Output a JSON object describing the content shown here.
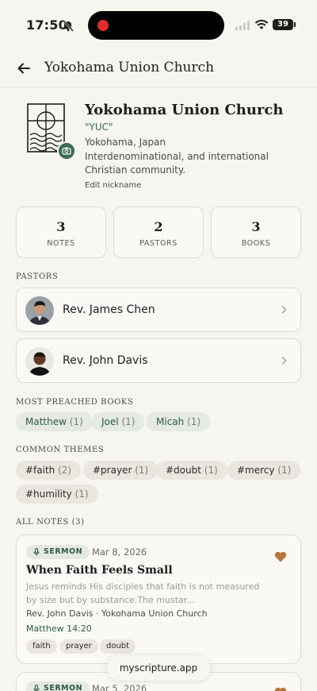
{
  "status_bar": {
    "time": "17:50",
    "battery": "39"
  },
  "header": {
    "title": "Yokohama Union Church"
  },
  "profile": {
    "name": "Yokohama Union Church",
    "nickname": "\"YUC\"",
    "location": "Yokohama, Japan",
    "description": "Interdenominational, and international Christian community.",
    "edit_nickname": "Edit nickname"
  },
  "stats": [
    {
      "value": "3",
      "label": "NOTES"
    },
    {
      "value": "2",
      "label": "PASTORS"
    },
    {
      "value": "3",
      "label": "BOOKS"
    }
  ],
  "pastors_section": {
    "title": "PASTORS",
    "items": [
      {
        "name": "Rev. James Chen"
      },
      {
        "name": "Rev. John Davis"
      }
    ]
  },
  "books_section": {
    "title": "MOST PREACHED BOOKS",
    "items": [
      {
        "name": "Matthew",
        "count": "(1)"
      },
      {
        "name": "Joel",
        "count": "(1)"
      },
      {
        "name": "Micah",
        "count": "(1)"
      }
    ]
  },
  "themes_section": {
    "title": "COMMON THEMES",
    "items": [
      {
        "name": "#faith",
        "count": "(2)"
      },
      {
        "name": "#prayer",
        "count": "(1)"
      },
      {
        "name": "#doubt",
        "count": "(1)"
      },
      {
        "name": "#mercy",
        "count": "(1)"
      },
      {
        "name": "#humility",
        "count": "(1)"
      }
    ]
  },
  "notes_section": {
    "title": "ALL NOTES (3)",
    "notes": [
      {
        "type": "SERMON",
        "date": "Mar 8, 2026",
        "title": "When Faith Feels Small",
        "excerpt": "Jesus reminds His disciples that faith is not measured by size but by substance.The mustar...",
        "meta": "Rev. John Davis · Yokohama Union Church",
        "reference": "Matthew 14:20",
        "tags": [
          "faith",
          "prayer",
          "doubt"
        ],
        "favorite": true
      },
      {
        "type": "SERMON",
        "date": "Mar 5, 2026",
        "favorite": true
      }
    ]
  },
  "footer": {
    "site": "myscripture.app"
  },
  "colors": {
    "accent": "#3e6b55",
    "heart": "#b8763a",
    "background": "#f6f5f0"
  }
}
